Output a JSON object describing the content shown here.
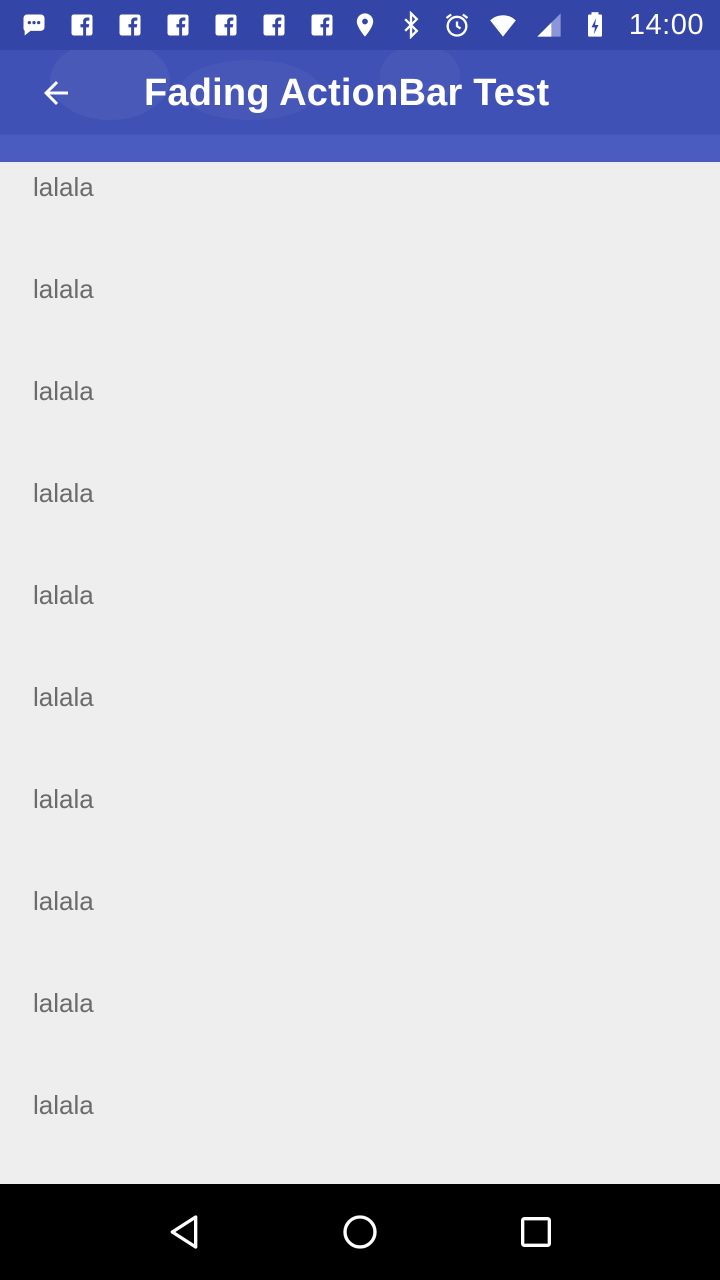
{
  "status_bar": {
    "time": "14:00",
    "left_icons": [
      "chat-icon",
      "facebook-icon",
      "facebook-icon",
      "facebook-icon",
      "facebook-icon",
      "facebook-icon",
      "facebook-icon"
    ],
    "right_icons": [
      "location-icon",
      "bluetooth-icon",
      "alarm-icon",
      "wifi-icon",
      "signal-icon",
      "battery-charging-icon"
    ]
  },
  "app_bar": {
    "title": "Fading ActionBar Test",
    "back_icon": "arrow-back-icon",
    "color": "#3f51b5"
  },
  "list": {
    "items": [
      "lalala",
      "lalala",
      "lalala",
      "lalala",
      "lalala",
      "lalala",
      "lalala",
      "lalala",
      "lalala",
      "lalala"
    ]
  },
  "nav_bar": {
    "buttons": [
      "back-triangle-icon",
      "home-circle-icon",
      "recents-square-icon"
    ]
  }
}
